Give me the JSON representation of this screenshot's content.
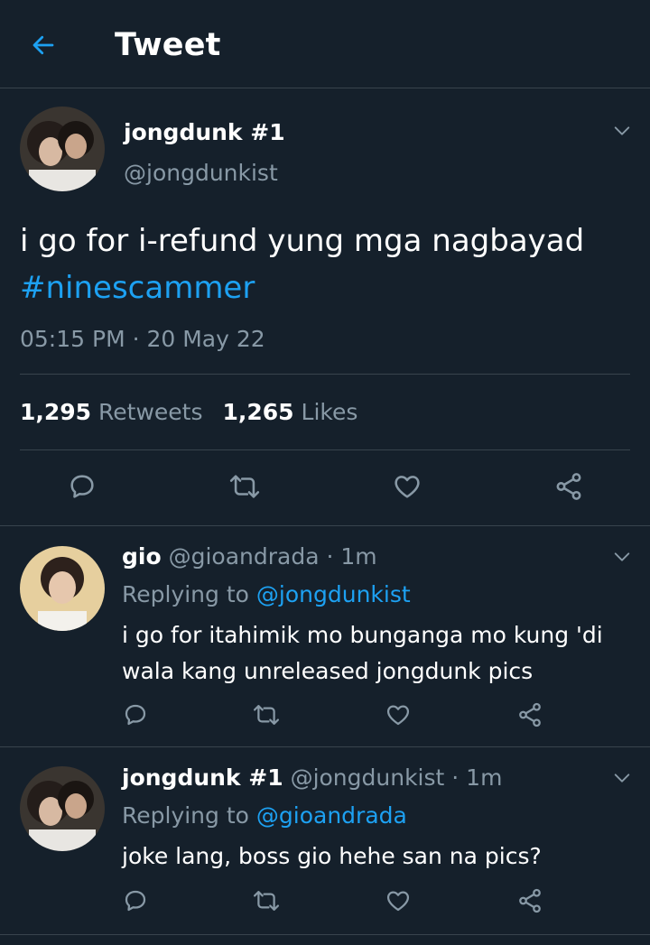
{
  "header": {
    "title": "Tweet",
    "back_icon": "arrow-left-icon"
  },
  "colors": {
    "background": "#15202b",
    "accent": "#1da1f2",
    "muted": "#8899a6",
    "divider": "#38444d"
  },
  "main_tweet": {
    "author_name": "jongdunk #1",
    "author_handle": "@jongdunkist",
    "text": "i go for i-refund yung mga nagbayad",
    "hashtag": "#ninescammer",
    "timestamp": "05:15 PM · 20 May 22",
    "retweets_count": "1,295",
    "retweets_label": "Retweets",
    "likes_count": "1,265",
    "likes_label": "Likes"
  },
  "replies": [
    {
      "name": "gio",
      "handle_time": "@gioandrada · 1m",
      "replying_label": "Replying to",
      "replying_to": "@jongdunkist",
      "text": "i go for itahimik mo bunganga mo kung 'di wala kang unreleased jongdunk pics"
    },
    {
      "name": "jongdunk #1",
      "handle_time": "@jongdunkist · 1m",
      "replying_label": "Replying to",
      "replying_to": "@gioandrada",
      "text": "joke lang, boss gio hehe san na pics?"
    }
  ]
}
